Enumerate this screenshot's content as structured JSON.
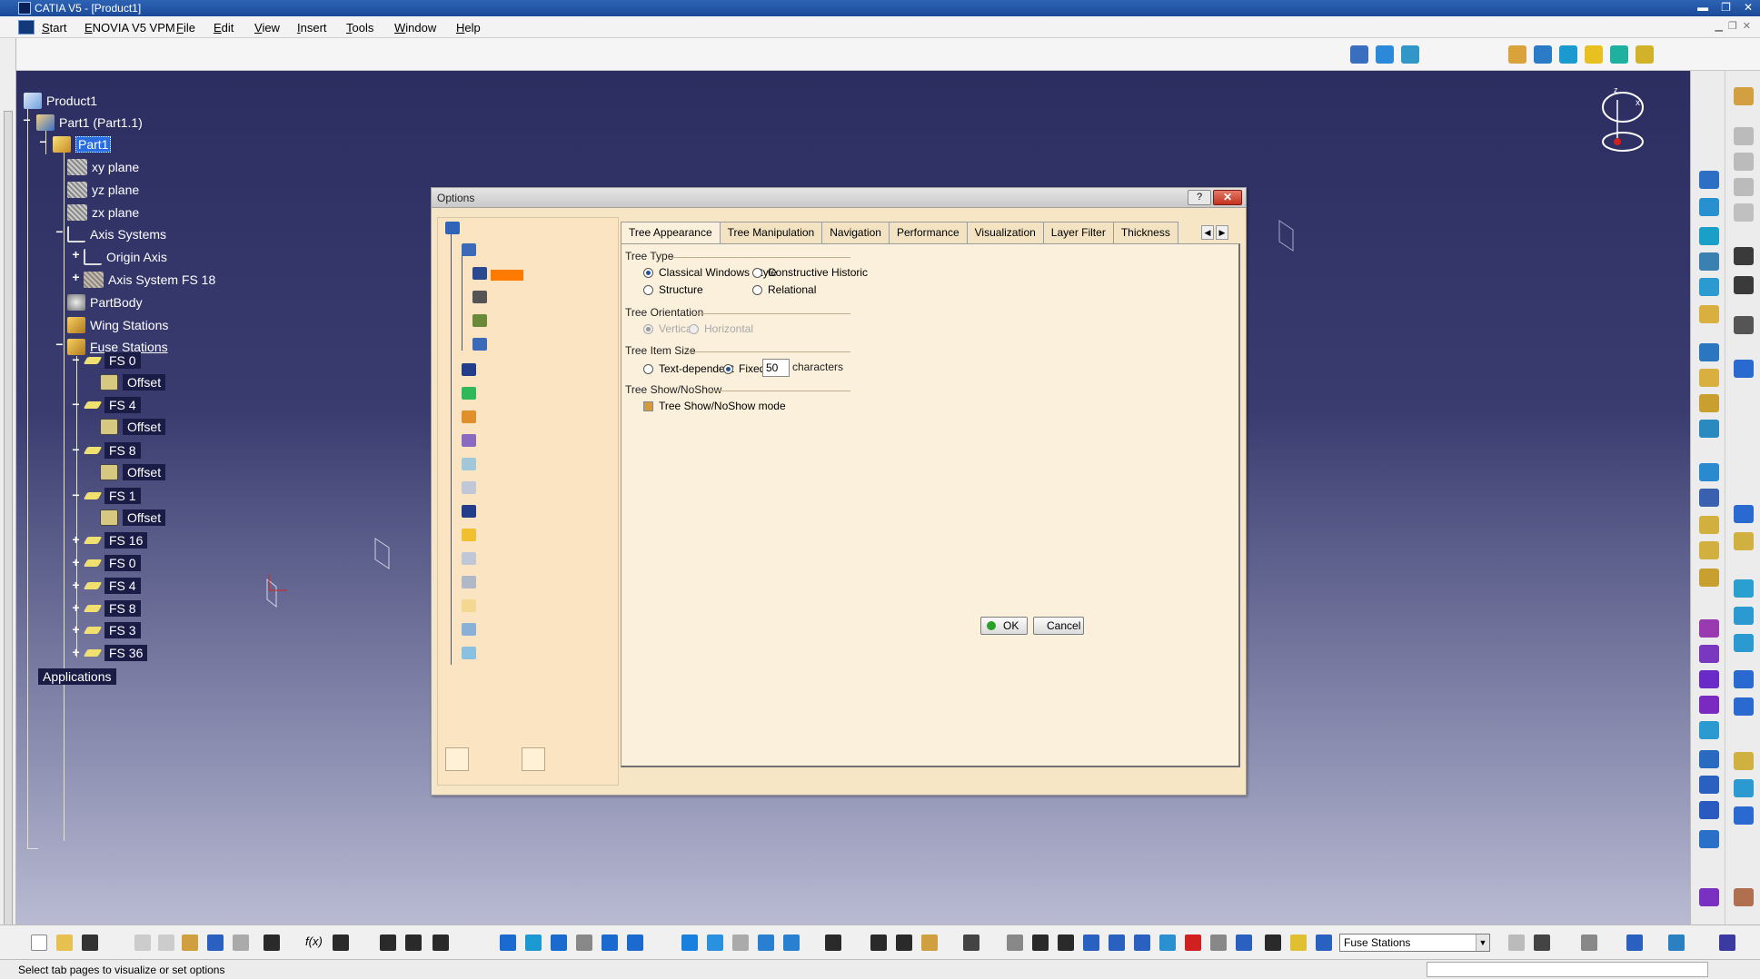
{
  "window": {
    "title": "CATIA V5 - [Product1]",
    "min": "▬",
    "restore": "❐",
    "close": "✕"
  },
  "menu": {
    "start": "Start",
    "items": [
      "ENOVIA V5 VPM",
      "File",
      "Edit",
      "View",
      "Insert",
      "Tools",
      "Window",
      "Help"
    ]
  },
  "tree": {
    "product": "Product1",
    "part_instance": "Part1 (Part1.1)",
    "part": "Part1",
    "xy": "xy plane",
    "yz": "yz plane",
    "zx": "zx plane",
    "axis_systems": "Axis Systems",
    "origin_axis": "Origin Axis",
    "axis_fs18": "Axis System FS 18",
    "partbody": "PartBody",
    "wing_stations": "Wing Stations",
    "fuse_stations": "Fuse Stations",
    "fs_expanded": [
      {
        "label": "FS 0",
        "child": "Offset"
      },
      {
        "label": "FS 4",
        "child": "Offset"
      },
      {
        "label": "FS 8",
        "child": "Offset"
      },
      {
        "label": "FS 1",
        "child": "Offset"
      }
    ],
    "fs_collapsed": [
      "FS 16",
      "FS 0",
      "FS 4",
      "FS 8",
      "FS 3",
      "FS 36"
    ],
    "applications": "Applications"
  },
  "dialog": {
    "title": "Options",
    "help": "?",
    "close": "✕",
    "tabs": [
      "Tree Appearance",
      "Tree Manipulation",
      "Navigation",
      "Performance",
      "Visualization",
      "Layer Filter",
      "Thickness"
    ],
    "active_tab": "Tree Appearance",
    "tree_type": {
      "title": "Tree Type",
      "classical": "Classical Windows Style",
      "constructive": "Constructive Historic",
      "structure": "Structure",
      "relational": "Relational",
      "selected": "Classical Windows Style"
    },
    "tree_orientation": {
      "title": "Tree Orientation",
      "vertical": "Vertical",
      "horizontal": "Horizontal",
      "selected": "Vertical"
    },
    "tree_item_size": {
      "title": "Tree Item Size",
      "text_dependent": "Text-dependent",
      "fixed": "Fixed:",
      "fixed_value": "50",
      "unit": "characters",
      "selected": "Fixed:"
    },
    "tree_show": {
      "title": "Tree Show/NoShow",
      "mode": "Tree Show/NoShow mode",
      "checked": true
    },
    "ok": "OK",
    "cancel": "Cancel"
  },
  "bottom": {
    "selection_combo": "Fuse Stations",
    "fx": "f(x)"
  },
  "status": {
    "message": "Select tab pages to visualize or set options"
  },
  "colors": {
    "viewport_top": "#2c2d60",
    "viewport_bottom": "#b9bad2",
    "dialog_bg": "#f6e6c6",
    "selection": "#2a6de0"
  }
}
